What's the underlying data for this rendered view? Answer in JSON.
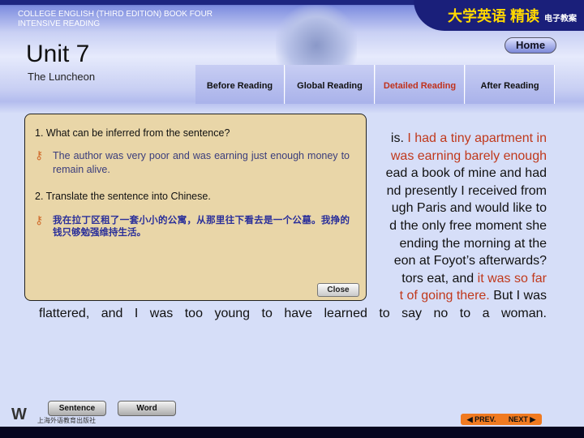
{
  "header": {
    "book_title_line1": "COLLEGE ENGLISH (THIRD EDITION) BOOK FOUR",
    "book_title_line2": "INTENSIVE READING",
    "cn_logo": "大学英语 精读",
    "cn_logo_small": "电子教案",
    "unit": "Unit 7",
    "lesson": "The Luncheon",
    "home": "Home"
  },
  "tabs": [
    {
      "label": "Before Reading"
    },
    {
      "label": "Global Reading"
    },
    {
      "label": "Detailed Reading",
      "active": true
    },
    {
      "label": "After Reading"
    }
  ],
  "passage": {
    "lines": [
      [
        {
          "t": "is. "
        },
        {
          "t": "I had a tiny apartment in",
          "red": true
        }
      ],
      [
        {
          "t": "was earning barely enough",
          "red": true
        }
      ],
      [
        {
          "t": "ead a book of mine and had"
        }
      ],
      [
        {
          "t": "nd presently I received from"
        }
      ],
      [
        {
          "t": "ugh Paris and would like to"
        }
      ],
      [
        {
          "t": "d the only free moment she"
        }
      ],
      [
        {
          "t": "ending the morning at the"
        }
      ],
      [
        {
          "t": "eon at Foyot’s afterwards?"
        }
      ],
      [
        {
          "t": "tors eat, and "
        },
        {
          "t": "it was so far",
          "red": true
        }
      ],
      [
        {
          "t": "t of going there.",
          "red": true
        },
        {
          "t": " But I was"
        }
      ],
      [
        {
          "t": "flattered, and I was too young to have learned to say no to a woman."
        }
      ]
    ]
  },
  "popup": {
    "q1": "1. What can be inferred from the sentence?",
    "a1": "The author was very poor and was earning just enough money to remain alive.",
    "q2": "2. Translate the sentence into Chinese.",
    "a2": "我在拉丁区租了一套小小的公寓，从那里往下看去是一个公墓。我挣的钱只够勉强维持生活。",
    "close": "Close"
  },
  "footer": {
    "sentence": "Sentence",
    "word": "Word",
    "publisher_logo": "W",
    "publisher": "上海外语教育出版社",
    "prev": "◀ PREV.",
    "next": "NEXT ▶"
  },
  "colors": {
    "highlight": "#c0391c",
    "popup_bg": "#e9d6a8",
    "nav": "#f07a20"
  }
}
